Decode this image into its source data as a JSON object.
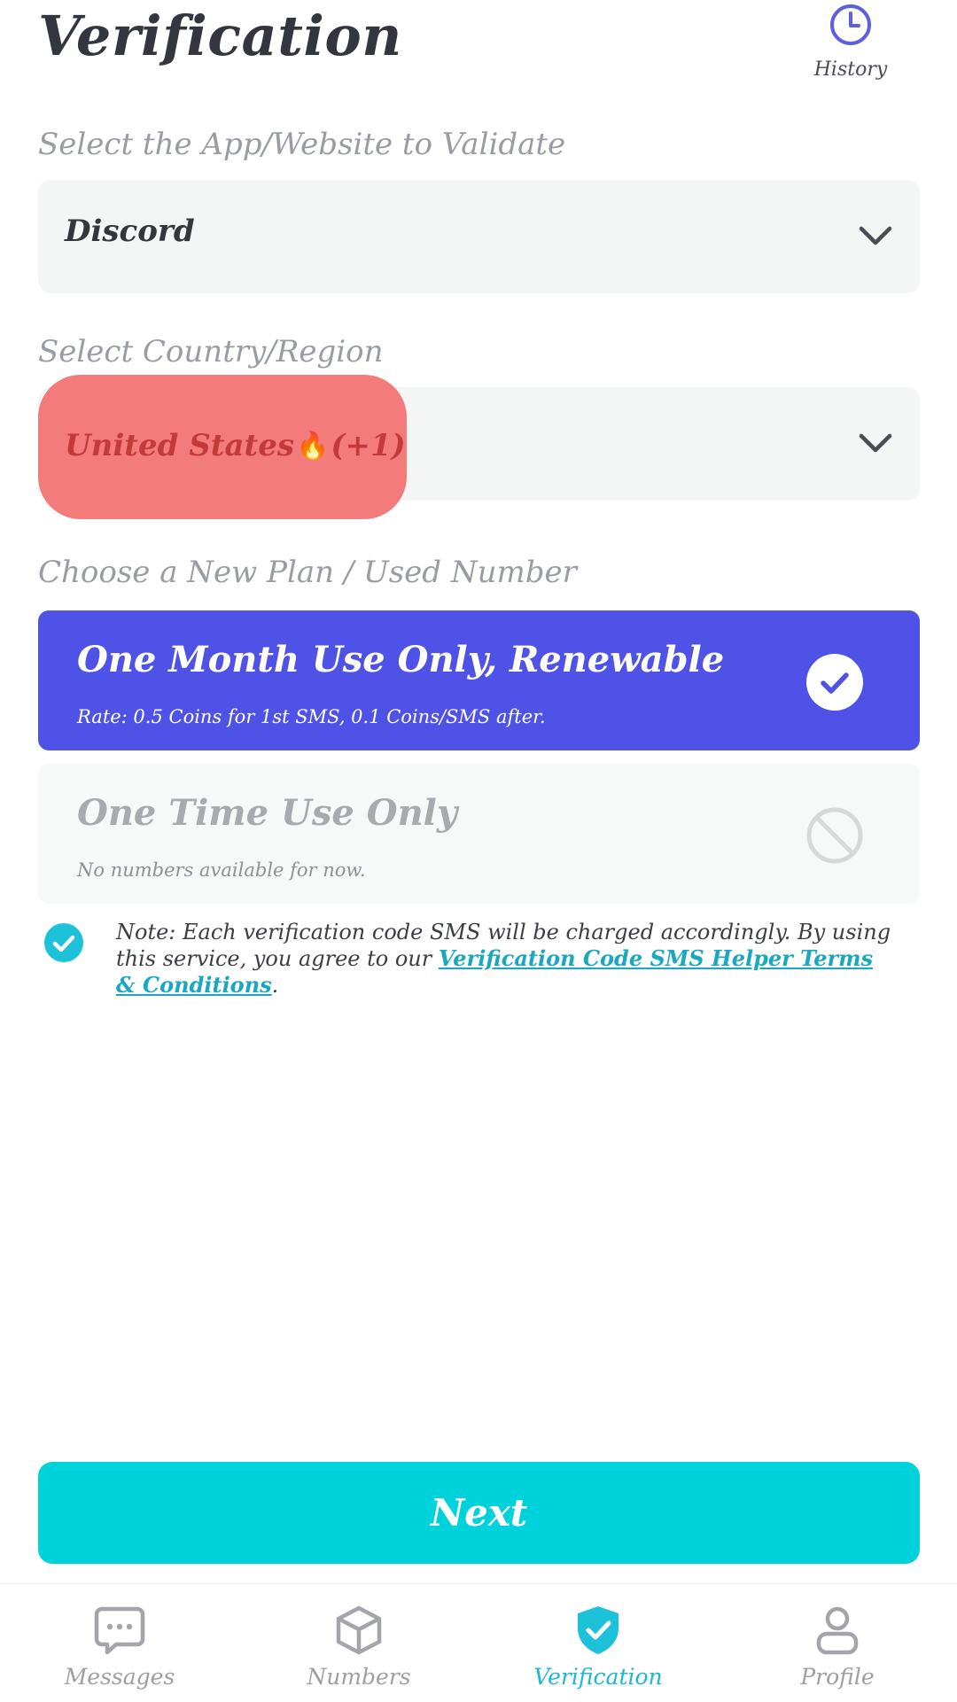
{
  "header": {
    "title": "Verification",
    "history_label": "History",
    "history_icon": "clock-icon"
  },
  "app_select": {
    "label": "Select the App/Website to Validate",
    "value": "Discord"
  },
  "country_select": {
    "label": "Select Country/Region",
    "country": "United States",
    "flame": "🔥",
    "code": "(+1)"
  },
  "plans": {
    "label": "Choose a New Plan / Used Number",
    "items": [
      {
        "title": "One Month Use Only, Renewable",
        "subtitle": "Rate: 0.5 Coins for 1st SMS, 0.1 Coins/SMS after.",
        "state": "selected"
      },
      {
        "title": "One Time Use Only",
        "subtitle": "No numbers available for now.",
        "state": "unavailable"
      }
    ]
  },
  "note": {
    "text": "Note: Each verification code SMS will be charged accordingly. By using this service, you agree to our ",
    "link": "Verification Code SMS Helper Terms & Conditions",
    "end": ".",
    "checked": true
  },
  "next_label": "Next",
  "nav": {
    "items": [
      {
        "label": "Messages",
        "icon": "chat-bubble-icon"
      },
      {
        "label": "Numbers",
        "icon": "cube-icon"
      },
      {
        "label": "Verification",
        "icon": "shield-check-icon",
        "active": true
      },
      {
        "label": "Profile",
        "icon": "person-icon"
      }
    ]
  },
  "colors": {
    "accent": "#4f52e6",
    "primary_button": "#00d2dc",
    "active_nav": "#1ab8d2",
    "highlight": "#f47b7b"
  }
}
